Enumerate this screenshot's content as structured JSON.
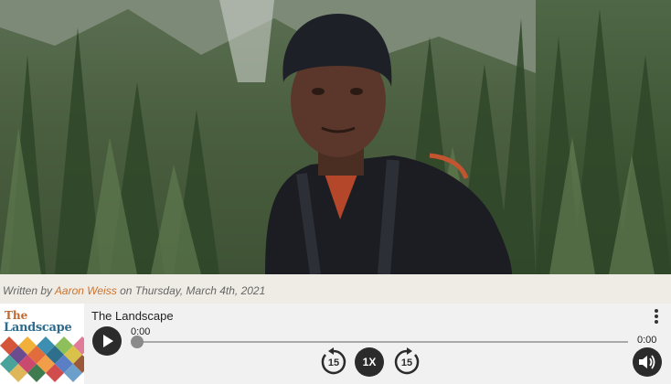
{
  "hero": {
    "photo_icon": "portrait-photo",
    "colors": {
      "forest": "#4a5f3f",
      "beanie": "#1d2026",
      "jacket": "#1b1d22",
      "shirt": "#b4472a"
    }
  },
  "byline": {
    "prefix": "Written by",
    "author": "Aaron Weiss",
    "middle": "on Thursday, March 4th, 2021",
    "author_color": "#c9742f"
  },
  "player": {
    "cover": {
      "line1": "The",
      "line2": "Landscape"
    },
    "episode_title": "The Landscape",
    "current_time": "0:00",
    "total_time": "0:00",
    "progress": 0,
    "rewind_seconds": "15",
    "forward_seconds": "15",
    "speed": "1X",
    "icons": {
      "menu": "more-vertical-icon",
      "play": "play-icon",
      "rewind": "rewind-15-icon",
      "forward": "forward-15-icon",
      "volume": "volume-icon"
    }
  }
}
